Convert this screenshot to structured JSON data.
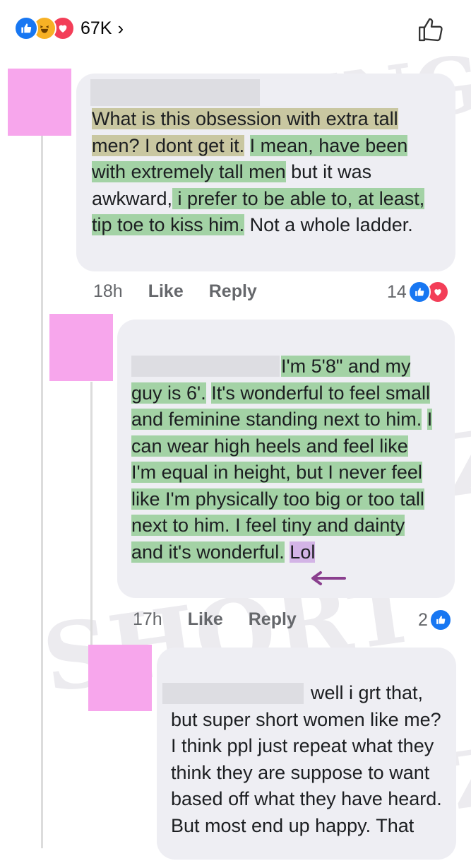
{
  "reactions_bar": {
    "count": "67K",
    "chevron": "›"
  },
  "comments": [
    {
      "text_parts": [
        {
          "text": "What is this obsession with extra tall men? I dont get it.",
          "hl": "khaki"
        },
        {
          "text": " ",
          "hl": ""
        },
        {
          "text": "I mean, have been with extremely tall men",
          "hl": "green"
        },
        {
          "text": " but it was awkward,",
          "hl": ""
        },
        {
          "text": " i prefer to be able to, at least, tip toe to kiss him.",
          "hl": "green"
        },
        {
          "text": " Not a whole ladder.",
          "hl": ""
        }
      ],
      "time": "18h",
      "like_label": "Like",
      "reply_label": "Reply",
      "reaction_count": "14"
    },
    {
      "text_parts": [
        {
          "text": "I'm 5'8\" and my guy is 6'.",
          "hl": "green"
        },
        {
          "text": " ",
          "hl": ""
        },
        {
          "text": "It's wonderful to feel small and feminine standing next to him.",
          "hl": "green"
        },
        {
          "text": " ",
          "hl": ""
        },
        {
          "text": "I can wear high heels and feel like I'm equal in height, but I never feel like I'm physically too big or too tall next to him. I feel tiny and dainty and it's wonderful.",
          "hl": "green"
        },
        {
          "text": " ",
          "hl": ""
        },
        {
          "text": "Lol",
          "hl": "purple"
        }
      ],
      "time": "17h",
      "like_label": "Like",
      "reply_label": "Reply",
      "reaction_count": "2"
    },
    {
      "text_parts": [
        {
          "text": "well i grt that, but super short women like me? I think ppl just repeat what they think they are suppose to want based off what they have heard. But most end up happy. That",
          "hl": ""
        }
      ]
    }
  ],
  "colors": {
    "highlight_green": "#a3d2a5",
    "highlight_khaki": "#c9c7a1",
    "highlight_purple": "#d3b4e6",
    "avatar_pink": "#f7a6ec",
    "like_blue": "#1877f2",
    "love_red": "#f33e58",
    "arrow_purple": "#8a3f8e"
  },
  "icons": {
    "like": "thumbs-up-icon",
    "haha": "laughing-face-icon",
    "love": "heart-icon",
    "arrow": "left-arrow-icon"
  }
}
